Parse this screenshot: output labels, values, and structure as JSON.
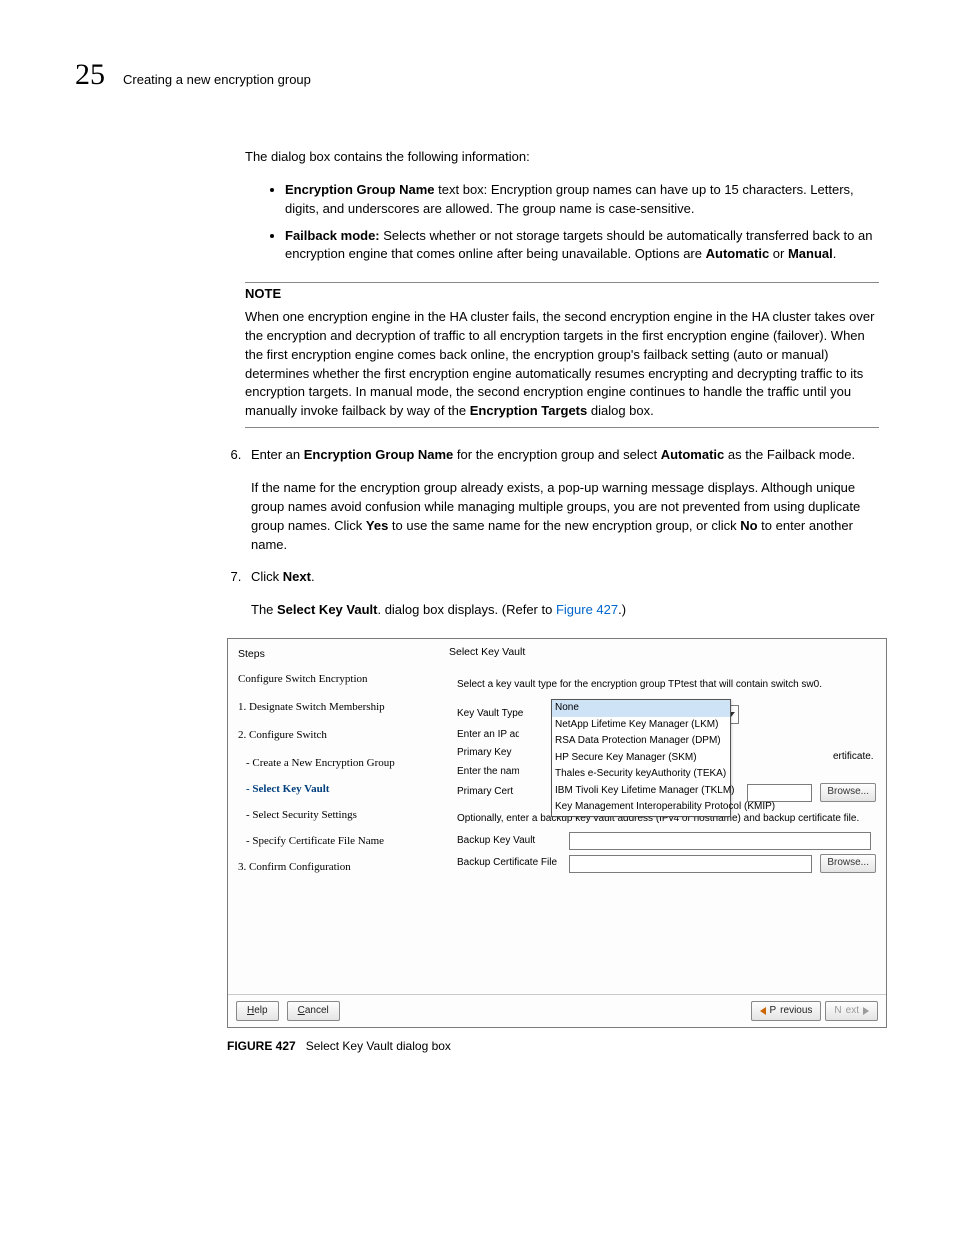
{
  "header": {
    "chapter": "25",
    "title": "Creating a new encryption group"
  },
  "intro": "The dialog box contains the following information:",
  "bullets": {
    "b1_label": "Encryption Group Name",
    "b1_rest": " text box: Encryption group names can have up to 15 characters. Letters, digits, and underscores are allowed. The group name is case-sensitive.",
    "b2_label": "Failback mode:",
    "b2_rest": " Selects whether or not storage targets should be automatically transferred back to an encryption engine that comes online after being unavailable. Options are ",
    "b2_opt1": "Automatic",
    "b2_or": " or ",
    "b2_opt2": "Manual",
    "b2_end": "."
  },
  "note": {
    "heading": "NOTE",
    "body_pre": "When one encryption engine in the HA cluster fails, the second encryption engine in the HA cluster takes over the encryption and decryption of traffic to all encryption targets in the first encryption engine (failover). When the first encryption engine comes back online, the encryption group's failback setting (auto or manual) determines whether the first encryption engine automatically resumes encrypting and decrypting traffic to its encryption targets. In manual mode, the second encryption engine continues to handle the traffic until you manually invoke failback by way of the ",
    "body_bold": "Encryption Targets",
    "body_post": " dialog box."
  },
  "steps": {
    "s6_a_pre": "Enter an ",
    "s6_a_b1": "Encryption Group Name",
    "s6_a_mid": " for the encryption group and select ",
    "s6_a_b2": "Automatic",
    "s6_a_post": " as the Failback mode.",
    "s6_b_pre": "If the name for the encryption group already exists, a pop-up warning message displays. Although unique group names avoid confusion while managing multiple groups, you are not prevented from using duplicate group names. Click ",
    "s6_b_b1": "Yes",
    "s6_b_mid": " to use the same name for the new encryption group, or click ",
    "s6_b_b2": "No",
    "s6_b_post": " to enter another name.",
    "s7_pre": "Click ",
    "s7_b": "Next",
    "s7_post": ".",
    "s7_para_pre": "The ",
    "s7_para_b": "Select Key Vault",
    "s7_para_mid": ". dialog box displays. (Refer to ",
    "s7_para_link": "Figure 427",
    "s7_para_post": ".)"
  },
  "screenshot": {
    "left": {
      "title": "Steps",
      "configure": "Configure Switch Encryption",
      "step1": "1. Designate Switch Membership",
      "step2": "2. Configure Switch",
      "sub_a": "- Create a New Encryption Group",
      "sub_b": "- Select Key Vault",
      "sub_c": "- Select Security Settings",
      "sub_d": "- Specify Certificate File Name",
      "step3": "3. Confirm Configuration"
    },
    "right": {
      "title": "Select Key Vault",
      "prompt": "Select a key vault type for the encryption group TPtest that will contain switch sw0.",
      "kv_type_label": "Key Vault Type",
      "kv_type_value": "None",
      "dropdown": {
        "o0": "None",
        "o1": "NetApp Lifetime Key Manager (LKM)",
        "o2": "RSA Data Protection Manager (DPM)",
        "o3": "HP Secure Key Manager (SKM)",
        "o4": "Thales e-Security keyAuthority (TEKA)",
        "o5": "IBM Tivoli Key Lifetime Manager (TKLM)",
        "o6": "Key Management Interoperability Protocol (KMIP)"
      },
      "enter_ip": "Enter an IP add",
      "primary_key_label": "Primary Key",
      "enter_name": "Enter the name",
      "primary_cert_label": "Primary Cert",
      "ertificate_right": "ertificate.",
      "browse": "Browse...",
      "optional": "Optionally, enter a backup key vault address (IPv4 or hostname) and backup certificate file.",
      "backup_kv_label": "Backup Key Vault",
      "backup_cert_label": "Backup Certificate File"
    },
    "footer": {
      "help_u": "H",
      "help_r": "elp",
      "cancel_u": "C",
      "cancel_r": "ancel",
      "prev_u": "P",
      "prev_r": "revious",
      "next_u": "N",
      "next_r": "ext"
    }
  },
  "figure_caption": {
    "label": "FIGURE 427",
    "text": "Select Key Vault dialog box"
  }
}
